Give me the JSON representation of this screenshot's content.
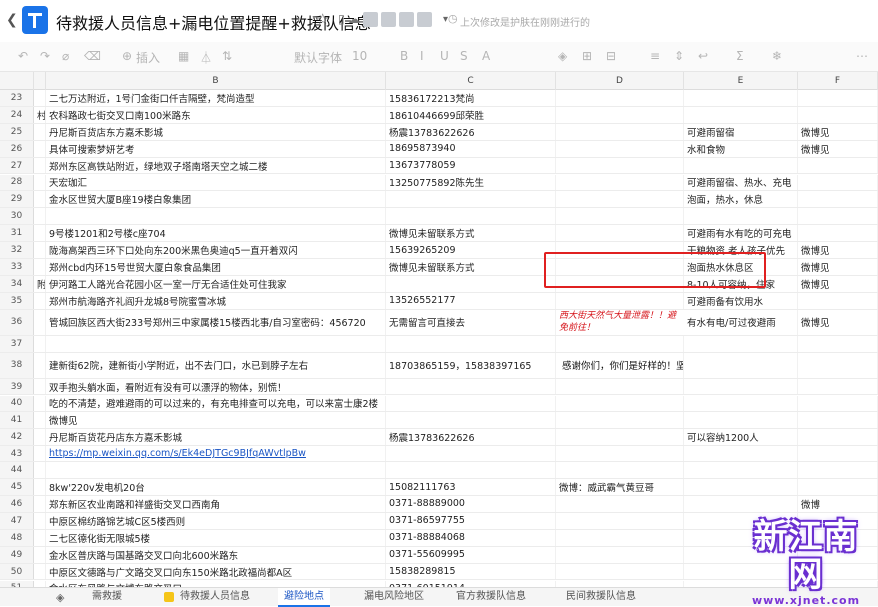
{
  "header": {
    "back_icon": "chevron-left-icon",
    "title": "待救援人员信息+漏电位置提醒+救援队信息",
    "saved_text": "上次修改是护肤在刚刚进行的"
  },
  "toolbar": {
    "insert_label": "插入",
    "font_label": "默认字体",
    "size_label": "10"
  },
  "columns": [
    "B",
    "C",
    "D",
    "E",
    "F"
  ],
  "rows": [
    {
      "num": "23",
      "a": "",
      "b": "二七万达附近，1号门金街口仟吉隔壁，梵尚造型",
      "c": "15836172213梵尚",
      "d": "",
      "e": "",
      "f": ""
    },
    {
      "num": "24",
      "a": "村",
      "b": "农科路政七街交叉口南100米路东",
      "c": "18610446699邱荣胜",
      "d": "",
      "e": "",
      "f": ""
    },
    {
      "num": "25",
      "a": "",
      "b": "丹尼斯百货店东方嘉禾影城",
      "c": "杨震13783622626",
      "d": "",
      "e": "可避雨留宿",
      "f": "微博见"
    },
    {
      "num": "26",
      "a": "",
      "b": "具体可搜索梦妍艺考",
      "c": "18695873940",
      "d": "",
      "e": "水和食物",
      "f": "微博见"
    },
    {
      "num": "27",
      "a": "",
      "b": "郑州东区高铁站附近，绿地双子塔南塔天空之城二楼",
      "c": "13673778059",
      "d": "",
      "e": "",
      "f": ""
    },
    {
      "num": "28",
      "a": "",
      "b": "天宏珈汇",
      "c": "13250775892陈先生",
      "d": "",
      "e": "可避雨留宿、热水、充电",
      "f": ""
    },
    {
      "num": "29",
      "a": "",
      "b": "金水区世贸大厦B座19楼白象集团",
      "c": "",
      "d": "",
      "e": "泡面，热水，休息",
      "f": ""
    },
    {
      "num": "30",
      "a": "",
      "b": "",
      "c": "",
      "d": "",
      "e": "",
      "f": ""
    },
    {
      "num": "31",
      "a": "",
      "b": "9号楼1201和2号楼c座704",
      "c": "微博见未留联系方式",
      "d": "",
      "e": "可避雨有水有吃的可充电",
      "f": ""
    },
    {
      "num": "32",
      "a": "",
      "b": "陇海高架西三环下口处向东200米黑色奥迪q5一直开着双闪",
      "c": "15639265209",
      "d": "",
      "e": "干粮物资 老人孩子优先",
      "f": "微博见"
    },
    {
      "num": "33",
      "a": "",
      "b": "郑州cbd内环15号世贸大厦白象食品集团",
      "c": "微博见未留联系方式",
      "d": "",
      "e": "泡面热水休息区",
      "f": "微博见"
    },
    {
      "num": "34",
      "a": "附",
      "b": "伊河路工人路光合花园小区一室一厅无合适住处可住我家",
      "c": "",
      "d": "",
      "e": "8-10人可容纳，住家",
      "f": "微博见"
    },
    {
      "num": "35",
      "a": "",
      "b": "郑州市航海路齐礼阎升龙城8号院蜜雪冰城",
      "c": "13526552177",
      "d": "",
      "e": "可避雨备有饮用水",
      "f": ""
    },
    {
      "num": "36",
      "a": "",
      "b": "管城回族区西大街233号郑州三中家属楼15楼西北事/自习室密码：456720",
      "c": "无需留言可直接去",
      "d": "西大街天然气大量泄露！！避免前往！",
      "e": "有水有电/可过夜避雨",
      "f": "微博见"
    },
    {
      "num": "37",
      "a": "",
      "b": "",
      "c": "",
      "d": "",
      "e": "",
      "f": ""
    },
    {
      "num": "38",
      "a": "",
      "b": "建新街62院，建新街小学附近，出不去门口，水已到脖子左右",
      "c": "18703865159，15838397165",
      "d": "感谢你们，你们是好样的！坚持住！郑州挺住！",
      "e": "",
      "f": ""
    },
    {
      "num": "39",
      "a": "",
      "b": "双手抱头躺水面，看附近有没有可以漂浮的物体，别慌！",
      "c": "",
      "d": "",
      "e": "",
      "f": ""
    },
    {
      "num": "40",
      "a": "",
      "b": "吃的不清楚，避难避雨的可以过来的，有充电排查可以充电，可以来富士康2楼",
      "c": "",
      "d": "",
      "e": "",
      "f": ""
    },
    {
      "num": "41",
      "a": "",
      "b": "微博见",
      "c": "",
      "d": "",
      "e": "",
      "f": ""
    },
    {
      "num": "42",
      "a": "",
      "b": "丹尼斯百货花丹店东方嘉禾影城",
      "c": "杨震13783622626",
      "d": "",
      "e": "可以容纳1200人",
      "f": ""
    },
    {
      "num": "43",
      "a": "",
      "b": "https://mp.weixin.qq.com/s/Ek4eDJTGc9BJfqAWvtlpBw",
      "c": "",
      "d": "",
      "e": "",
      "f": ""
    },
    {
      "num": "44",
      "a": "",
      "b": "",
      "c": "",
      "d": "",
      "e": "",
      "f": ""
    },
    {
      "num": "45",
      "a": "",
      "b": "8kw'220v发电机20台",
      "c": "15082111763",
      "d": "微博：威武霸气黄豆哥",
      "e": "",
      "f": ""
    },
    {
      "num": "46",
      "a": "",
      "b": "郑东新区农业南路和祥盛街交叉口西南角",
      "c": "0371-88889000",
      "d": "",
      "e": "",
      "f": "微博"
    },
    {
      "num": "47",
      "a": "",
      "b": "中原区棉纺路锦艺城C区5楼西则",
      "c": "0371-86597755",
      "d": "",
      "e": "",
      "f": ""
    },
    {
      "num": "48",
      "a": "",
      "b": "二七区德化街无限城5楼",
      "c": "0371-88884068",
      "d": "",
      "e": "",
      "f": ""
    },
    {
      "num": "49",
      "a": "",
      "b": "金水区普庆路与国基路交叉口向北600米路东",
      "c": "0371-55609995",
      "d": "",
      "e": "",
      "f": ""
    },
    {
      "num": "50",
      "a": "",
      "b": "中原区文德路与广文路交叉口向东150米路北政福尚都A区",
      "c": "15838289815",
      "d": "",
      "e": "",
      "f": ""
    },
    {
      "num": "51",
      "a": "",
      "b": "金水区东风路与文博东路交叉口",
      "c": "0371-60151914",
      "d": "",
      "e": "",
      "f": ""
    }
  ],
  "tabs": [
    {
      "label": "需救援"
    },
    {
      "label": "待救援人员信息"
    },
    {
      "label": "避险地点"
    },
    {
      "label": "漏电风险地区"
    },
    {
      "label": "官方救援队信息"
    },
    {
      "label": "民间救援队信息"
    }
  ],
  "watermark": {
    "main": "新江南网",
    "url": "www.xjnet.com"
  }
}
